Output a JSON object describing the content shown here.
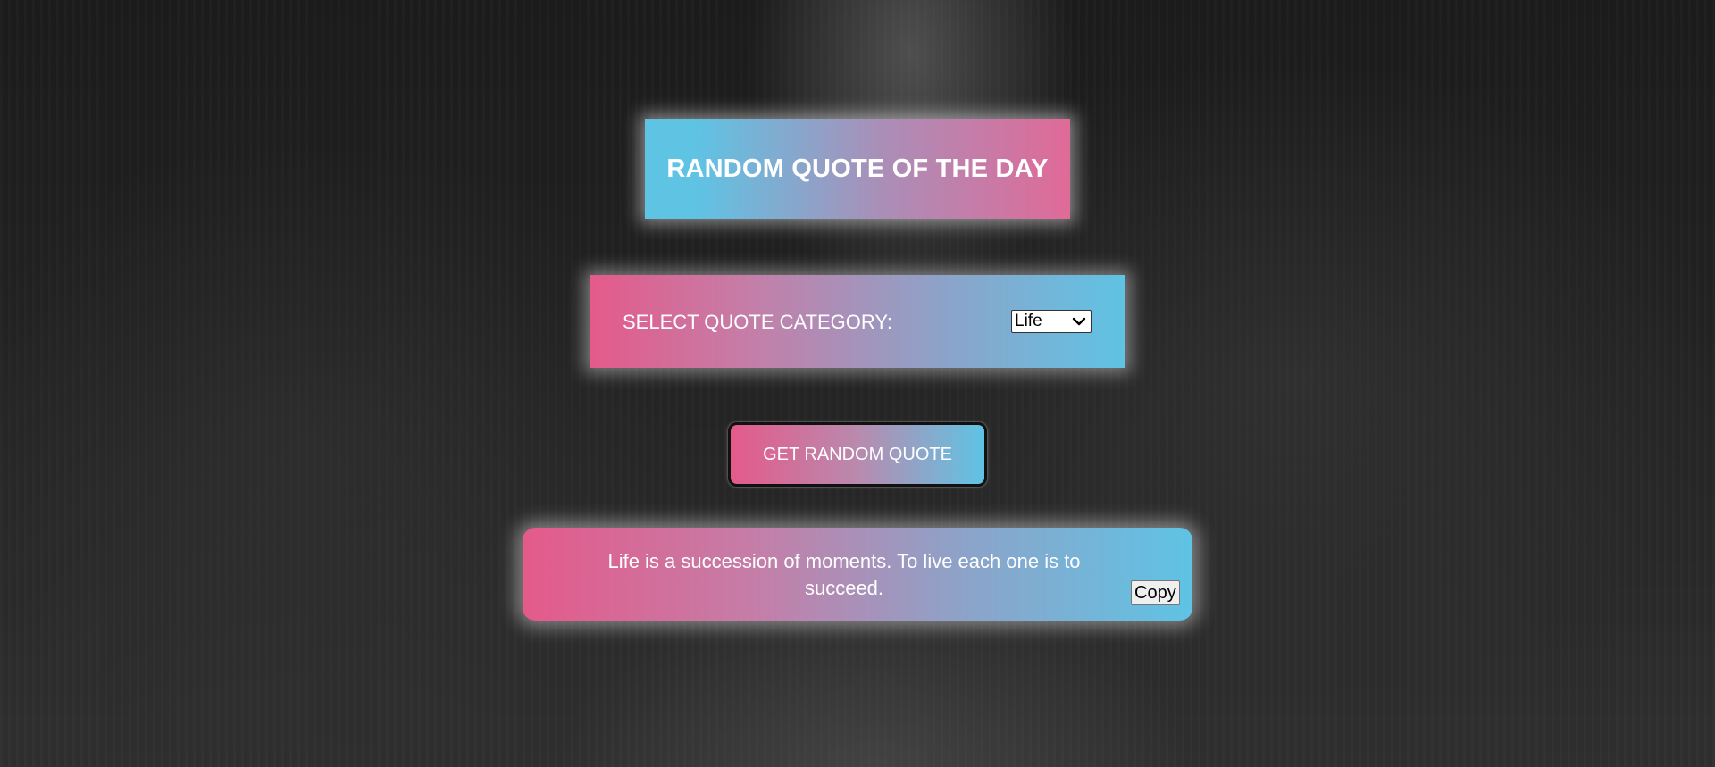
{
  "header": {
    "title": "RANDOM QUOTE OF THE DAY"
  },
  "category": {
    "label": "SELECT QUOTE CATEGORY:",
    "selected": "Life",
    "icon": "chevron-down-icon"
  },
  "actions": {
    "get_quote_label": "GET RANDOM QUOTE"
  },
  "quote": {
    "text": "Life is a succession of moments. To live each one is to succeed.",
    "copy_label": "Copy"
  },
  "colors": {
    "pink": "#e45a8a",
    "blue": "#5fc3e4",
    "background": "#222222",
    "text": "#ffffff"
  }
}
